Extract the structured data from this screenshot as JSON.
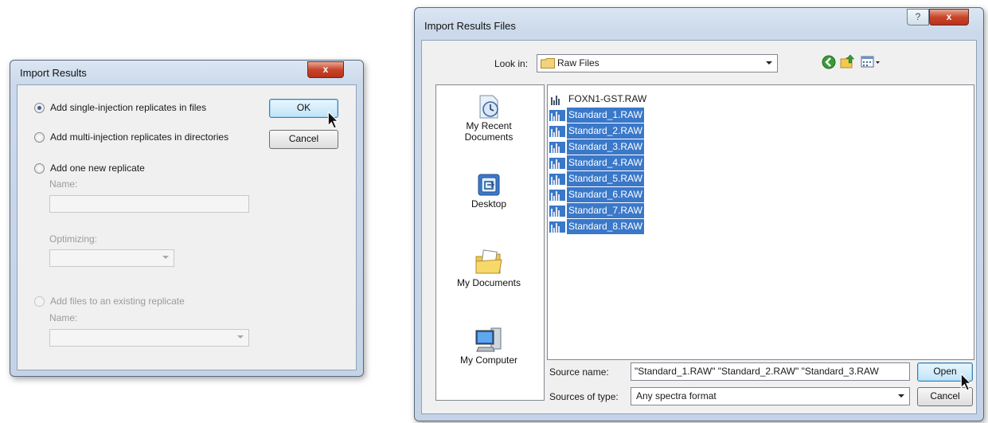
{
  "import_results": {
    "title": "Import Results",
    "close_glyph": "x",
    "options": {
      "single_injection": "Add single-injection replicates in files",
      "multi_injection": "Add multi-injection replicates in directories",
      "one_new": "Add one new replicate",
      "name_label": "Name:",
      "optimizing_label": "Optimizing:",
      "existing": "Add files to an existing replicate",
      "existing_name_label": "Name:"
    },
    "selected_option": "single_injection",
    "ok_label": "OK",
    "cancel_label": "Cancel"
  },
  "import_files": {
    "title": "Import Results Files",
    "help_glyph": "?",
    "close_glyph": "x",
    "look_in_label": "Look in:",
    "look_in_value": "Raw Files",
    "places": [
      {
        "label": "My Recent Documents",
        "icon": "recent-documents-icon"
      },
      {
        "label": "Desktop",
        "icon": "desktop-icon"
      },
      {
        "label": "My Documents",
        "icon": "my-documents-icon"
      },
      {
        "label": "My Computer",
        "icon": "my-computer-icon"
      }
    ],
    "files": [
      {
        "name": "FOXN1-GST.RAW",
        "selected": false
      },
      {
        "name": "Standard_1.RAW",
        "selected": true
      },
      {
        "name": "Standard_2.RAW",
        "selected": true
      },
      {
        "name": "Standard_3.RAW",
        "selected": true
      },
      {
        "name": "Standard_4.RAW",
        "selected": true
      },
      {
        "name": "Standard_5.RAW",
        "selected": true
      },
      {
        "name": "Standard_6.RAW",
        "selected": true
      },
      {
        "name": "Standard_7.RAW",
        "selected": true
      },
      {
        "name": "Standard_8.RAW",
        "selected": true
      }
    ],
    "source_name_label": "Source name:",
    "source_name_value": "\"Standard_1.RAW\" \"Standard_2.RAW\" \"Standard_3.RAW",
    "source_type_label": "Sources of type:",
    "source_type_value": "Any spectra format",
    "open_label": "Open",
    "cancel_label": "Cancel"
  },
  "colors": {
    "selection": "#3a78c9",
    "close_button": "#c8452a",
    "default_button": "#bfe4f9"
  }
}
